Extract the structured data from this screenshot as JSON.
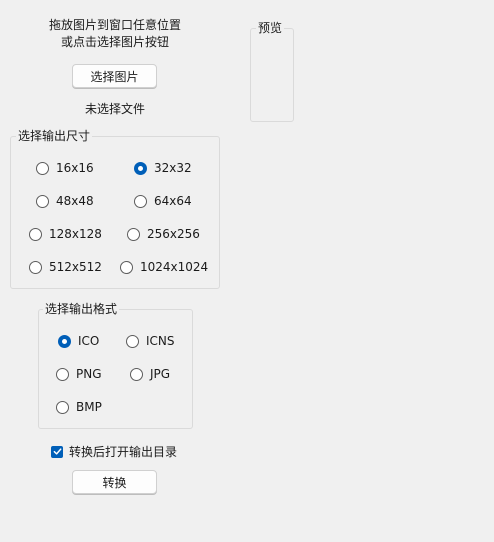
{
  "drop_hint": {
    "line1": "拖放图片到窗口任意位置",
    "line2": "或点击选择图片按钮"
  },
  "select_image_button": "选择图片",
  "file_status": "未选择文件",
  "preview": {
    "title": "预览"
  },
  "size_group": {
    "title": "选择输出尺寸",
    "options": [
      {
        "label": "16x16",
        "selected": false
      },
      {
        "label": "32x32",
        "selected": true
      },
      {
        "label": "48x48",
        "selected": false
      },
      {
        "label": "64x64",
        "selected": false
      },
      {
        "label": "128x128",
        "selected": false
      },
      {
        "label": "256x256",
        "selected": false
      },
      {
        "label": "512x512",
        "selected": false
      },
      {
        "label": "1024x1024",
        "selected": false
      }
    ]
  },
  "format_group": {
    "title": "选择输出格式",
    "options": [
      {
        "label": "ICO",
        "selected": true
      },
      {
        "label": "ICNS",
        "selected": false
      },
      {
        "label": "PNG",
        "selected": false
      },
      {
        "label": "JPG",
        "selected": false
      },
      {
        "label": "BMP",
        "selected": false
      }
    ]
  },
  "open_dir_checkbox": {
    "label": "转换后打开输出目录",
    "checked": true
  },
  "convert_button": "转换",
  "colors": {
    "accent": "#005fb8",
    "background": "#f0f0f0"
  }
}
